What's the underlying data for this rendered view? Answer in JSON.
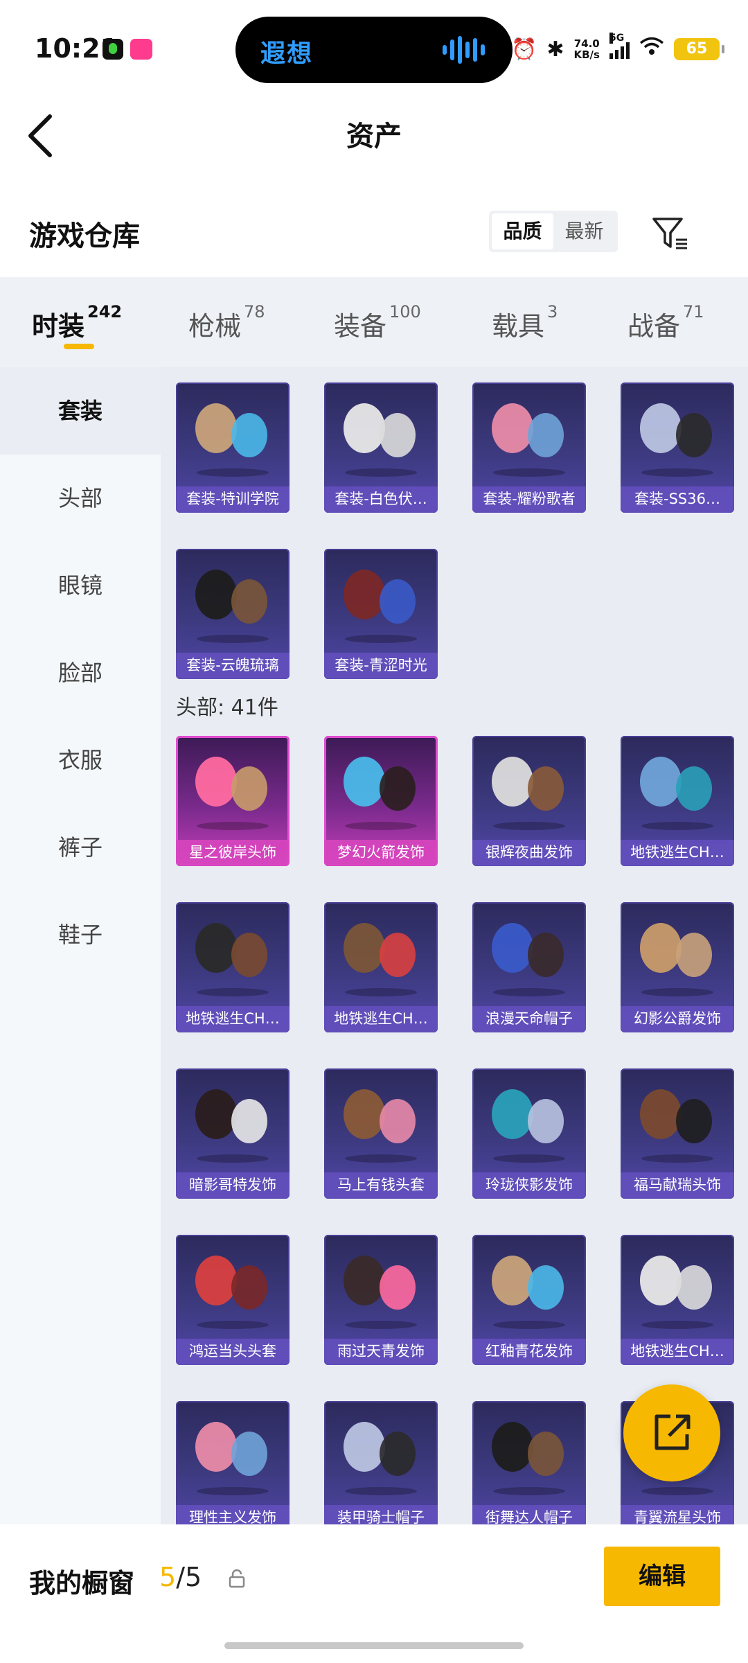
{
  "status": {
    "time": "10:21",
    "island_logo": "遐想",
    "speed_value": "74.0",
    "speed_unit": "KB/s",
    "network": "5G",
    "battery": "65"
  },
  "header": {
    "title": "资产"
  },
  "warehouse": {
    "title": "游戏仓库",
    "sort_options": [
      "品质",
      "最新"
    ],
    "active_sort": "品质"
  },
  "tabs": [
    {
      "label": "时装",
      "count": "242"
    },
    {
      "label": "枪械",
      "count": "78"
    },
    {
      "label": "装备",
      "count": "100"
    },
    {
      "label": "载具",
      "count": "3"
    },
    {
      "label": "战备",
      "count": "71"
    }
  ],
  "sidebar": {
    "items": [
      {
        "label": "套装"
      },
      {
        "label": "头部"
      },
      {
        "label": "眼镜"
      },
      {
        "label": "脸部"
      },
      {
        "label": "衣服"
      },
      {
        "label": "裤子"
      },
      {
        "label": "鞋子"
      }
    ]
  },
  "sections": {
    "head_title": "头部: 41件"
  },
  "suits": [
    {
      "name": "套装-特训学院"
    },
    {
      "name": "套装-白色伏…"
    },
    {
      "name": "套装-耀粉歌者"
    },
    {
      "name": "套装-SS36…"
    },
    {
      "name": "套装-云魄琉璃"
    },
    {
      "name": "套装-青涩时光"
    }
  ],
  "head_items": [
    {
      "name": "星之彼岸头饰"
    },
    {
      "name": "梦幻火箭发饰"
    },
    {
      "name": "银辉夜曲发饰"
    },
    {
      "name": "地铁逃生CH…"
    },
    {
      "name": "地铁逃生CH…"
    },
    {
      "name": "地铁逃生CH…"
    },
    {
      "name": "浪漫天命帽子"
    },
    {
      "name": "幻影公爵发饰"
    },
    {
      "name": "暗影哥特发饰"
    },
    {
      "name": "马上有钱头套"
    },
    {
      "name": "玲珑侠影发饰"
    },
    {
      "name": "福马献瑞头饰"
    },
    {
      "name": "鸿运当头头套"
    },
    {
      "name": "雨过天青发饰"
    },
    {
      "name": "红釉青花发饰"
    },
    {
      "name": "地铁逃生CH…"
    },
    {
      "name": "理性主义发饰"
    },
    {
      "name": "装甲骑士帽子"
    },
    {
      "name": "街舞达人帽子"
    },
    {
      "name": "青翼流星头饰"
    }
  ],
  "showcase": {
    "label": "我的橱窗",
    "current": "5",
    "total": "/5",
    "edit_label": "编辑"
  }
}
